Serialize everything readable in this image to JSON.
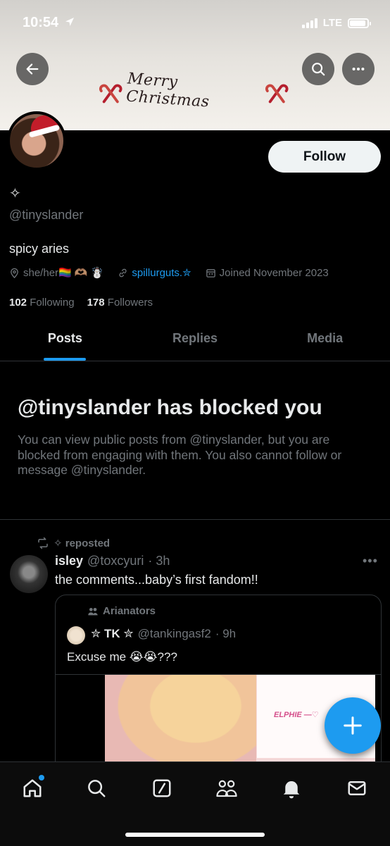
{
  "status_bar": {
    "time": "10:54",
    "network": "LTE",
    "battery_level": 0.9
  },
  "banner": {
    "text": "Merry Christmas"
  },
  "profile": {
    "display_name": "✧",
    "handle": "@tinyslander",
    "bio": "spicy aries",
    "pronouns": "she/her🏳️‍🌈 🫶🏽 ☃️",
    "link": "spillurguts.✮",
    "joined": "Joined November 2023",
    "following_count": "102",
    "following_label": "Following",
    "followers_count": "178",
    "followers_label": "Followers",
    "follow_button": "Follow"
  },
  "tabs": [
    {
      "label": "Posts",
      "active": true
    },
    {
      "label": "Replies",
      "active": false
    },
    {
      "label": "Media",
      "active": false
    }
  ],
  "blocked": {
    "title": "@tinyslander has blocked you",
    "text": "You can view public posts from @tinyslander, but you are blocked from engaging with them. You also cannot follow or message @tinyslander."
  },
  "post": {
    "repost_label": "✧ reposted",
    "name": "isley",
    "handle": "@toxcyuri",
    "time": "· 3h",
    "text": "the comments...baby’s first fandom!!",
    "quote": {
      "community": "Arianators",
      "name": "✮ TK ✮",
      "handle": "@tankingasf2",
      "time": "· 9h",
      "text": "Excuse me 😭😭???",
      "image_text": "ELPHIE —♡"
    }
  },
  "bottom_nav": [
    "home-icon",
    "search-icon",
    "grok-icon",
    "communities-icon",
    "notifications-icon",
    "messages-icon"
  ]
}
